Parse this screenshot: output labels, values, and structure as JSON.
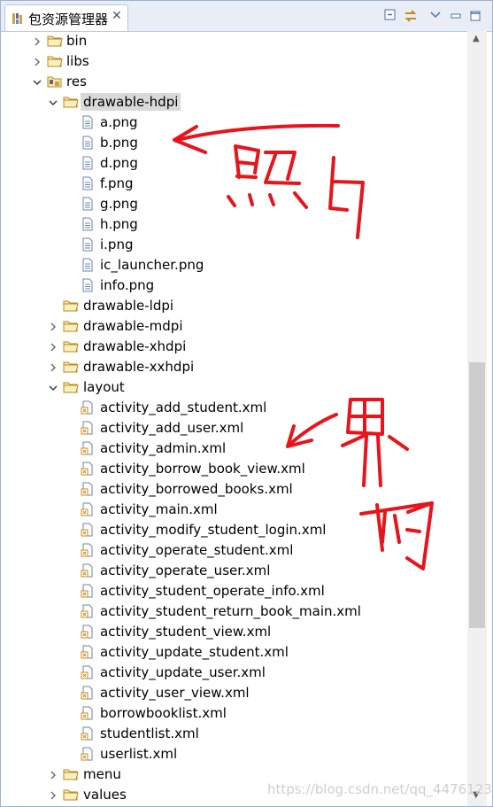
{
  "panel": {
    "title": "包资源管理器",
    "close_glyph": "✕"
  },
  "toolbar": [
    {
      "name": "collapse-all-icon"
    },
    {
      "name": "link-with-editor-icon"
    },
    {
      "name": "view-menu-icon"
    },
    {
      "name": "minimize-icon"
    },
    {
      "name": "maximize-icon"
    }
  ],
  "tree": [
    {
      "label": "bin",
      "depth": 1,
      "type": "folder",
      "toggle": "collapsed"
    },
    {
      "label": "libs",
      "depth": 1,
      "type": "folder",
      "toggle": "collapsed"
    },
    {
      "label": "res",
      "depth": 1,
      "type": "folder-res",
      "toggle": "expanded"
    },
    {
      "label": "drawable-hdpi",
      "depth": 2,
      "type": "folder",
      "toggle": "expanded",
      "selected": true
    },
    {
      "label": "a.png",
      "depth": 3,
      "type": "image"
    },
    {
      "label": "b.png",
      "depth": 3,
      "type": "image"
    },
    {
      "label": "d.png",
      "depth": 3,
      "type": "image"
    },
    {
      "label": "f.png",
      "depth": 3,
      "type": "image"
    },
    {
      "label": "g.png",
      "depth": 3,
      "type": "image"
    },
    {
      "label": "h.png",
      "depth": 3,
      "type": "image"
    },
    {
      "label": "i.png",
      "depth": 3,
      "type": "image"
    },
    {
      "label": "ic_launcher.png",
      "depth": 3,
      "type": "image"
    },
    {
      "label": "info.png",
      "depth": 3,
      "type": "image"
    },
    {
      "label": "drawable-ldpi",
      "depth": 2,
      "type": "folder",
      "toggle": "none"
    },
    {
      "label": "drawable-mdpi",
      "depth": 2,
      "type": "folder",
      "toggle": "collapsed"
    },
    {
      "label": "drawable-xhdpi",
      "depth": 2,
      "type": "folder",
      "toggle": "collapsed"
    },
    {
      "label": "drawable-xxhdpi",
      "depth": 2,
      "type": "folder",
      "toggle": "collapsed"
    },
    {
      "label": "layout",
      "depth": 2,
      "type": "folder",
      "toggle": "expanded"
    },
    {
      "label": "activity_add_student.xml",
      "depth": 3,
      "type": "xml"
    },
    {
      "label": "activity_add_user.xml",
      "depth": 3,
      "type": "xml"
    },
    {
      "label": "activity_admin.xml",
      "depth": 3,
      "type": "xml"
    },
    {
      "label": "activity_borrow_book_view.xml",
      "depth": 3,
      "type": "xml"
    },
    {
      "label": "activity_borrowed_books.xml",
      "depth": 3,
      "type": "xml"
    },
    {
      "label": "activity_main.xml",
      "depth": 3,
      "type": "xml"
    },
    {
      "label": "activity_modify_student_login.xml",
      "depth": 3,
      "type": "xml"
    },
    {
      "label": "activity_operate_student.xml",
      "depth": 3,
      "type": "xml"
    },
    {
      "label": "activity_operate_user.xml",
      "depth": 3,
      "type": "xml"
    },
    {
      "label": "activity_student_operate_info.xml",
      "depth": 3,
      "type": "xml"
    },
    {
      "label": "activity_student_return_book_main.xml",
      "depth": 3,
      "type": "xml"
    },
    {
      "label": "activity_student_view.xml",
      "depth": 3,
      "type": "xml"
    },
    {
      "label": "activity_update_student.xml",
      "depth": 3,
      "type": "xml"
    },
    {
      "label": "activity_update_user.xml",
      "depth": 3,
      "type": "xml"
    },
    {
      "label": "activity_user_view.xml",
      "depth": 3,
      "type": "xml"
    },
    {
      "label": "borrowbooklist.xml",
      "depth": 3,
      "type": "xml"
    },
    {
      "label": "studentlist.xml",
      "depth": 3,
      "type": "xml"
    },
    {
      "label": "userlist.xml",
      "depth": 3,
      "type": "xml"
    },
    {
      "label": "menu",
      "depth": 2,
      "type": "folder",
      "toggle": "collapsed"
    },
    {
      "label": "values",
      "depth": 2,
      "type": "folder",
      "toggle": "collapsed"
    }
  ],
  "scrollbar": {
    "up_glyph": "▲",
    "down_glyph": "▼"
  },
  "annotations": {
    "note_images": "照片",
    "note_layouts": "界面",
    "ink_color": "#e8141b"
  },
  "watermark": "https://blog.csdn.net/qq_4476123"
}
